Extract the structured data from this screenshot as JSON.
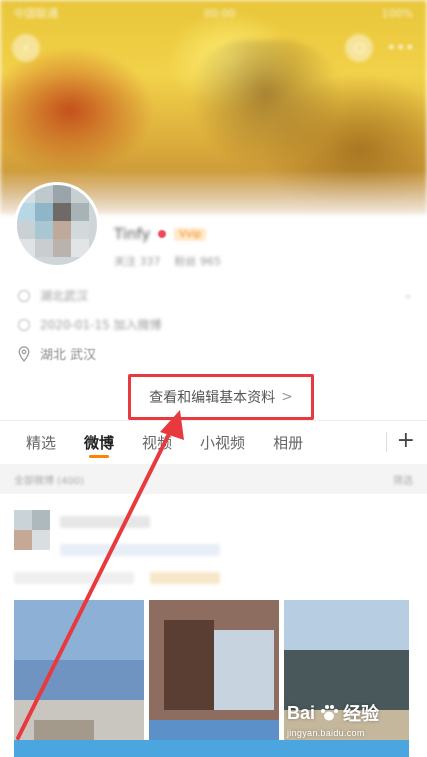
{
  "status_bar": {
    "carrier": "中国联通",
    "time": "00:00",
    "battery": "100%"
  },
  "profile": {
    "name": "Tinfy",
    "vip_badge": "Vvip",
    "stats": [
      "关注 337",
      "粉丝 965"
    ],
    "info": [
      "湖北武汉",
      "2020-01-15 加入微博"
    ],
    "location": "湖北 武汉"
  },
  "edit_profile": {
    "label": "查看和编辑基本资料",
    "chevron": ">"
  },
  "tabs": [
    {
      "label": "精选",
      "active": false
    },
    {
      "label": "微博",
      "active": true
    },
    {
      "label": "视频",
      "active": false
    },
    {
      "label": "小视频",
      "active": false
    },
    {
      "label": "相册",
      "active": false
    }
  ],
  "tab_add": "+",
  "filter_bar": {
    "left": "全部微博 (400)",
    "right": "筛选"
  },
  "watermark": {
    "brand_left": "Bai",
    "brand_right": "经验",
    "url": "jingyan.baidu.com"
  },
  "colors": {
    "accent": "#ff8200",
    "annotation_red": "#e8393e",
    "vip": "#f04a5a"
  }
}
